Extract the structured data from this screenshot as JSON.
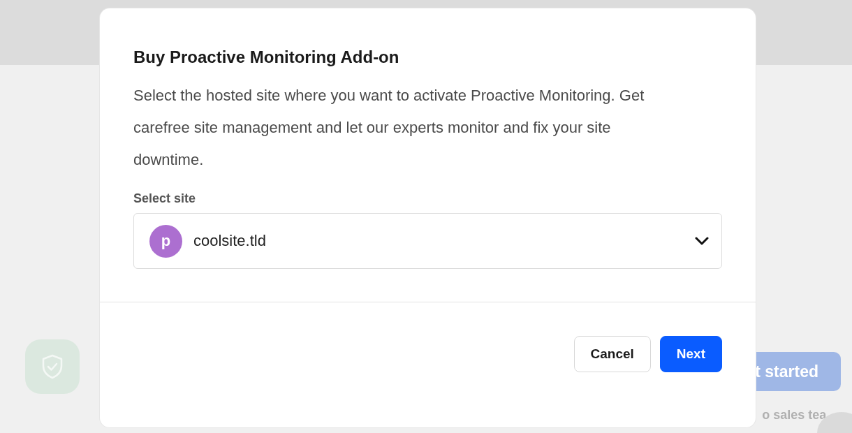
{
  "background": {
    "start_button": "t started",
    "sales_link": "o sales tea"
  },
  "dialog": {
    "title": "Buy Proactive Monitoring Add-on",
    "description": "Select the hosted site where you want to activate Proactive Monitoring. Get carefree site management and let our experts monitor and fix your site downtime.",
    "site_select": {
      "label": "Select site",
      "avatar_letter": "p",
      "value": "coolsite.tld"
    },
    "buttons": [
      {
        "label": "Cancel",
        "kind": "secondary"
      },
      {
        "label": "Next",
        "kind": "primary"
      }
    ]
  }
}
